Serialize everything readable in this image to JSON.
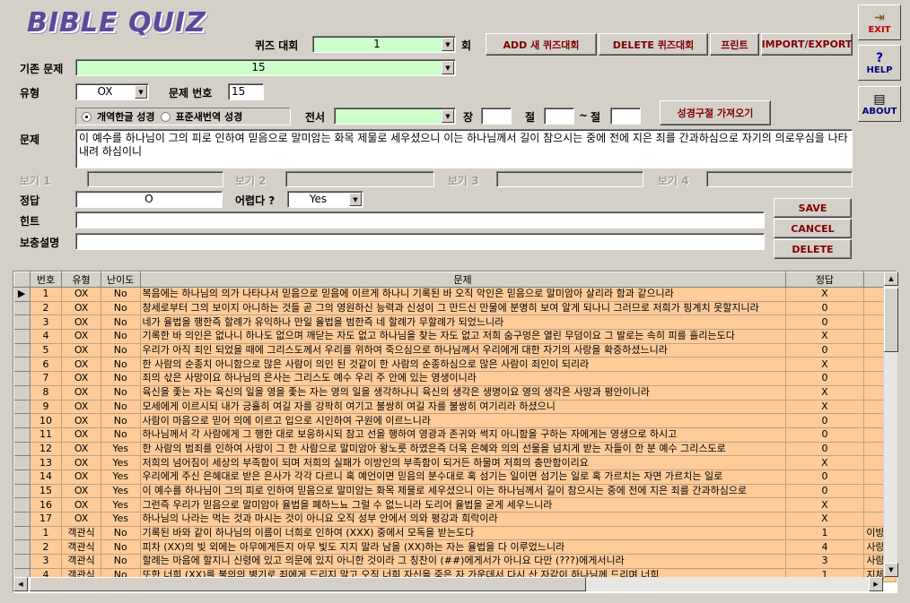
{
  "app": {
    "logo": "BIBLE QUIZ"
  },
  "header": {
    "quiz_label": "퀴즈 대회",
    "quiz_value": "1",
    "quiz_suffix": "회",
    "add_button": "ADD 새 퀴즈대회",
    "delete_button": "DELETE 퀴즈대회",
    "print_button": "프린트",
    "import_export_button": "IMPORT/EXPORT"
  },
  "side": {
    "exit": "EXIT",
    "help": "HELP",
    "about": "ABOUT",
    "exit_icon": "exit-door-icon",
    "help_icon": "question-mark-icon",
    "about_icon": "book-icon"
  },
  "form": {
    "base_label": "기존 문제",
    "base_value": "15",
    "type_label": "유형",
    "type_value": "OX",
    "qno_label": "문제 번호",
    "qno_value": "15",
    "radio1": "개역한글 성경",
    "radio2": "표준새번역 성경",
    "book_label": "전서",
    "book_value": "",
    "chapter_label": "장",
    "verse_label": "절",
    "tilde": "~",
    "verse2_label": "절",
    "fetch_button": "성경구절 가져오기",
    "question_label": "문제",
    "question_value": "이 예수를 하나님이 그의 피로 인하여 믿음으로 말미암는 화목 제물로 세우셨으니 이는 하나님께서 길이 참으시는 중에 전에 지은 죄를 간과하심으로 자기의 의로우심을 나타내려 하심이니",
    "choice1_label": "보기 1",
    "choice2_label": "보기 2",
    "choice3_label": "보기 3",
    "choice4_label": "보기 4",
    "answer_label": "정답",
    "answer_value": "O",
    "difficulty_label": "어렵다 ?",
    "difficulty_value": "Yes",
    "hint_label": "힌트",
    "extra_label": "보충설명",
    "save_button": "SAVE",
    "cancel_button": "CANCEL",
    "delete_button": "DELETE"
  },
  "grid": {
    "headers": [
      "번호",
      "유형",
      "난이도",
      "문제",
      "정답",
      ""
    ],
    "rows": [
      [
        "1",
        "OX",
        "No",
        "복음에는 하나님의 의가 나타나서 믿음으로 믿음에 이르게 하나니 기록된 바 오직 악인은 믿음으로 말미암아 살리라 함과 같으니라",
        "X",
        ""
      ],
      [
        "2",
        "OX",
        "No",
        "창세로부터 그의 보이지 아니하는 것들 곧 그의 영원하신 능력과 신성이 그 만드신 만물에 분명히 보여 알게 되나니 그러므로 저희가 핑계치 못할지니라",
        "0",
        ""
      ],
      [
        "3",
        "OX",
        "No",
        "네가 율법을 행한즉 할례가 유익하나 만일 율법을 범한즉 네 할례가 무할례가 되었느니라",
        "0",
        ""
      ],
      [
        "4",
        "OX",
        "No",
        "기록한 바 의인은 없나니 하나도 없으며 깨닫는 자도 없고 하나님을 찾는 자도 없고 저희 숨구멍은 열린 무덤이요 그 발로는 속히 피를 흘리는도다",
        "X",
        ""
      ],
      [
        "5",
        "OX",
        "No",
        "우리가 아직 죄인 되었을 때에 그리스도께서 우리를 위하여 죽으심으로 하나님께서 우리에게 대한 자기의 사랑을 확증하셨느니라",
        "0",
        ""
      ],
      [
        "6",
        "OX",
        "No",
        "한 사람의 순종치 아니함으로 많은 사람이 의인 된 것같이 한 사람의 순종하심으로 많은 사람이 죄인이 되리라",
        "X",
        ""
      ],
      [
        "7",
        "OX",
        "No",
        "죄의 삯은 사망이요 하나님의 은사는 그리스도 예수 우리 주 안에 있는 영생이니라",
        "0",
        ""
      ],
      [
        "8",
        "OX",
        "No",
        "육신을 좇는 자는 육신의 일을 영을 좇는 자는 영의 일을 생각하나니 육신의 생각은 생명이요 영의 생각은 사망과 평안이니라",
        "X",
        ""
      ],
      [
        "9",
        "OX",
        "No",
        "모세에게 이르시되 내가 긍휼히 여길 자를 강팍히 여기고 불쌍히 여길 자를 불쌍히 여기리라 하셨으니",
        "X",
        ""
      ],
      [
        "10",
        "OX",
        "No",
        "사람이 마음으로 믿어 의에 이르고 입으로 시인하여 구원에 이르느니라",
        "0",
        ""
      ],
      [
        "11",
        "OX",
        "No",
        "하나님께서 각 사람에게 그 행한 대로 보응하시되 참고 선을 행하여 영광과 존귀와 썩지 아니함을 구하는 자에게는 영생으로 하시고",
        "0",
        ""
      ],
      [
        "12",
        "OX",
        "Yes",
        "한 사람의 범죄를 인하여 사망이 그 한 사람으로 말미암아 왕노릇 하였은즉 더욱 은혜와 의의 선물을 넘치게 받는 자들이 한 분 예수 그리스도로",
        "0",
        ""
      ],
      [
        "13",
        "OX",
        "Yes",
        "저희의 넘어짐이 세상의 부족함이 되며 저희의 실패가 이방인의 부족함이 되거든 하물며 저희의 충만함이리요",
        "X",
        ""
      ],
      [
        "14",
        "OX",
        "Yes",
        "우리에게 주신 은혜대로 받은 은사가 각각 다르니 혹 예언이면 믿음의 분수대로 혹 섬기는 일이면 섬기는 일로 혹 가르치는 자면 가르치는 일로",
        "0",
        ""
      ],
      [
        "15",
        "OX",
        "Yes",
        "이 예수를 하나님이 그의 피로 인하여 믿음으로 말미암는 화목 제물로 세우셨으니 이는 하나님께서 길이 참으시는 중에 전에 지은 죄를 간과하심으로",
        "0",
        ""
      ],
      [
        "16",
        "OX",
        "Yes",
        "그런즉 우리가 믿음으로 말미암아 율법을 폐하느뇨 그럴 수 없느니라 도리어 율법을 굳게 세우느니라",
        "X",
        ""
      ],
      [
        "17",
        "OX",
        "Yes",
        "하나님의 나라는 먹는 것과 마시는 것이 아니요 오직 성부 안에서 의와 평강과 희락이라",
        "X",
        ""
      ],
      [
        "1",
        "객관식",
        "No",
        "기록된 바와 같이 하나님의 이름이 너희로 인하여        (XXX) 중에서 모독을 받는도다",
        "1",
        "이방"
      ],
      [
        "2",
        "객관식",
        "No",
        "피차 (XX)의 빚 외에는 아무에게든지 아무 빛도 지지 말라 남을 (XX)하는 자는 율법을 다 이루었느니라",
        "4",
        "사랑"
      ],
      [
        "3",
        "객관식",
        "No",
        "할례는 마음에 할지니 신령에 있고 의문에 있지 아니한 것이라 그 칭찬이 (##)에게서가 아니요 다만 (???)에게서니라",
        "3",
        "사람"
      ],
      [
        "4",
        "객관식",
        "No",
        "또한 너희 (XX)를 불의의 병기로 죄에게 드리지 말고 오직 너희 자신을 죽은 자 가운데서 다시 산 자같이 하나님께 드리며 너희",
        "1",
        "지체"
      ]
    ]
  }
}
